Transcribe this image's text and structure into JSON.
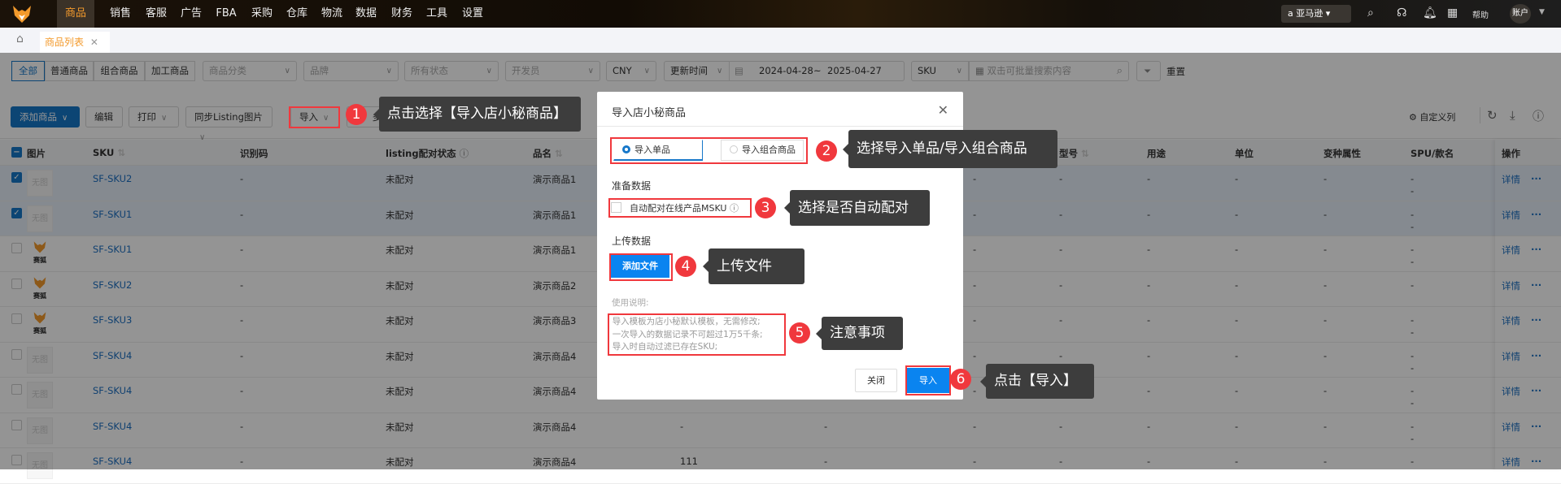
{
  "nav": {
    "items": [
      "商品",
      "销售",
      "客服",
      "广告",
      "FBA",
      "采购",
      "仓库",
      "物流",
      "数据",
      "财务",
      "工具",
      "设置"
    ],
    "active": 0,
    "platform": "亚马逊",
    "help": "帮助",
    "account": "账户"
  },
  "tabs": {
    "home": "home-icon",
    "items": [
      {
        "label": "商品列表"
      }
    ]
  },
  "filters": {
    "types": [
      "全部",
      "普通商品",
      "组合商品",
      "加工商品"
    ],
    "category": "商品分类",
    "brand": "品牌",
    "status": "所有状态",
    "developer": "开发员",
    "currency": "CNY",
    "time_field": "更新时间",
    "date_from": "2024-04-28",
    "date_sep": "~",
    "date_to": "2025-04-27",
    "search_field": "SKU",
    "search_placeholder": "双击可批量搜索内容",
    "reset": "重置"
  },
  "toolbar": {
    "add": "添加商品",
    "edit": "编辑",
    "print": "打印",
    "sync": "同步Listing图片",
    "import": "导入",
    "more": "多",
    "custom_cols": "自定义列"
  },
  "table": {
    "headers": {
      "image": "图片",
      "sku": "SKU",
      "code": "识别码",
      "listing": "listing配对状态",
      "name": "品名",
      "model": "型号",
      "usage": "用途",
      "unit": "单位",
      "variant": "变种属性",
      "spu": "SPU/款名",
      "ops": "操作"
    },
    "no_image": "无图",
    "fox_label": "赛狐",
    "detail": "详情",
    "more": "···",
    "rows": [
      {
        "checked": true,
        "img": "none",
        "sku": "SF-SKU2",
        "code": "-",
        "listing": "未配对",
        "name": "演示商品1",
        "c1": "-",
        "c2": "-",
        "c3": "-",
        "model": "-",
        "usage": "-",
        "unit": "-",
        "variant": "-",
        "spu": "-",
        "spu2": "-"
      },
      {
        "checked": true,
        "img": "none",
        "sku": "SF-SKU1",
        "code": "-",
        "listing": "未配对",
        "name": "演示商品1",
        "c1": "-",
        "c2": "-",
        "c3": "-",
        "model": "-",
        "usage": "-",
        "unit": "-",
        "variant": "-",
        "spu": "-",
        "spu2": "-"
      },
      {
        "checked": false,
        "img": "fox",
        "sku": "SF-SKU1",
        "code": "-",
        "listing": "未配对",
        "name": "演示商品1",
        "c1": "-",
        "c2": "-",
        "c3": "-",
        "model": "-",
        "usage": "-",
        "unit": "-",
        "variant": "-",
        "spu": "-",
        "spu2": "-"
      },
      {
        "checked": false,
        "img": "fox",
        "sku": "SF-SKU2",
        "code": "-",
        "listing": "未配对",
        "name": "演示商品2",
        "c1": "-",
        "c2": "-",
        "c3": "-",
        "model": "-",
        "usage": "-",
        "unit": "-",
        "variant": "-",
        "spu": "-",
        "spu2": ""
      },
      {
        "checked": false,
        "img": "fox",
        "sku": "SF-SKU3",
        "code": "-",
        "listing": "未配对",
        "name": "演示商品3",
        "c1": "-",
        "c2": "-",
        "c3": "-",
        "model": "-",
        "usage": "-",
        "unit": "-",
        "variant": "-",
        "spu": "-",
        "spu2": "-"
      },
      {
        "checked": false,
        "img": "none",
        "sku": "SF-SKU4",
        "code": "-",
        "listing": "未配对",
        "name": "演示商品4",
        "c1": "-",
        "c2": "-",
        "c3": "-",
        "model": "-",
        "usage": "-",
        "unit": "-",
        "variant": "-",
        "spu": "-",
        "spu2": "-"
      },
      {
        "checked": false,
        "img": "none",
        "sku": "SF-SKU4",
        "code": "-",
        "listing": "未配对",
        "name": "演示商品4",
        "c1": "-",
        "c2": "-",
        "c3": "-",
        "model": "-",
        "usage": "-",
        "unit": "-",
        "variant": "-",
        "spu": "-",
        "spu2": "-"
      },
      {
        "checked": false,
        "img": "none",
        "sku": "SF-SKU4",
        "code": "-",
        "listing": "未配对",
        "name": "演示商品4",
        "c1": "-",
        "c2": "-",
        "c3": "-",
        "model": "-",
        "usage": "-",
        "unit": "-",
        "variant": "-",
        "spu": "-",
        "spu2": "-"
      },
      {
        "checked": false,
        "img": "none",
        "sku": "SF-SKU4",
        "code": "-",
        "listing": "未配对",
        "name": "演示商品4",
        "c1": "111",
        "c2": "-",
        "c3": "-",
        "model": "-",
        "usage": "-",
        "unit": "-",
        "variant": "-",
        "spu": "-",
        "spu2": ""
      }
    ]
  },
  "modal": {
    "title": "导入店小秘商品",
    "options": [
      "导入单品",
      "导入组合商品"
    ],
    "selected": 0,
    "prepare": "准备数据",
    "auto_match": "自动配对在线产品MSKU",
    "upload": "上传数据",
    "add_file": "添加文件",
    "notes_title": "使用说明:",
    "notes": [
      "导入模板为店小秘默认模板，无需修改;",
      "一次导入的数据记录不可超过1万5千条;",
      "导入时自动过滤已存在SKU;"
    ],
    "close": "关闭",
    "import": "导入"
  },
  "guide": [
    {
      "n": "1",
      "text": "点击选择【导入店小秘商品】"
    },
    {
      "n": "2",
      "text": "选择导入单品/导入组合商品"
    },
    {
      "n": "3",
      "text": "选择是否自动配对"
    },
    {
      "n": "4",
      "text": "上传文件"
    },
    {
      "n": "5",
      "text": "注意事项"
    },
    {
      "n": "6",
      "text": "点击【导入】"
    }
  ],
  "colors": {
    "accent": "#1677c9",
    "brand_orange": "#f39a2c",
    "guide_red": "#f0383d"
  }
}
